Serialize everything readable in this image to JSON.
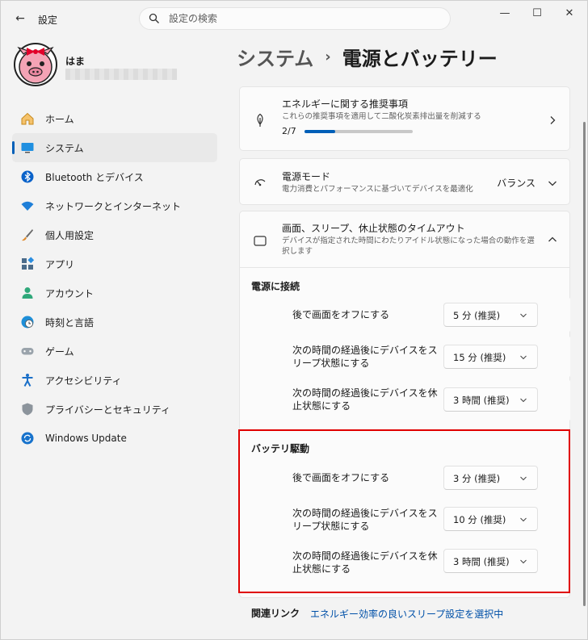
{
  "window": {
    "app_title": "設定",
    "back_icon": "←",
    "min_icon": "—",
    "max_icon": "☐",
    "close_icon": "✕"
  },
  "search": {
    "placeholder": "設定の検索"
  },
  "profile": {
    "name": "はま"
  },
  "sidebar": {
    "items": [
      {
        "label": "ホーム",
        "icon": "home-icon"
      },
      {
        "label": "システム",
        "icon": "system-icon",
        "active": true
      },
      {
        "label": "Bluetooth とデバイス",
        "icon": "bluetooth-icon"
      },
      {
        "label": "ネットワークとインターネット",
        "icon": "wifi-icon"
      },
      {
        "label": "個人用設定",
        "icon": "brush-icon"
      },
      {
        "label": "アプリ",
        "icon": "apps-icon"
      },
      {
        "label": "アカウント",
        "icon": "account-icon"
      },
      {
        "label": "時刻と言語",
        "icon": "globe-clock-icon"
      },
      {
        "label": "ゲーム",
        "icon": "gamepad-icon"
      },
      {
        "label": "アクセシビリティ",
        "icon": "accessibility-icon"
      },
      {
        "label": "プライバシーとセキュリティ",
        "icon": "shield-icon"
      },
      {
        "label": "Windows Update",
        "icon": "update-icon"
      }
    ]
  },
  "breadcrumb": {
    "parent": "システム",
    "separator": "›",
    "current": "電源とバッテリー"
  },
  "recommendations": {
    "title": "エネルギーに関する推奨事項",
    "subtitle": "これらの推奨事項を適用して二酸化炭素排出量を削減する",
    "progress_text": "2/7",
    "progress_value": 0.286
  },
  "power_mode": {
    "title": "電源モード",
    "subtitle": "電力消費とパフォーマンスに基づいてデバイスを最適化",
    "value": "バランス"
  },
  "timeouts": {
    "title": "画面、スリープ、休止状態のタイムアウト",
    "subtitle": "デバイスが指定された時間にわたりアイドル状態になった場合の動作を選択します"
  },
  "plugged_in": {
    "label": "電源に接続",
    "rows": [
      {
        "label": "後で画面をオフにする",
        "value": "5 分 (推奨)"
      },
      {
        "label": "次の時間の経過後にデバイスをスリープ状態にする",
        "value": "15 分 (推奨)"
      },
      {
        "label": "次の時間の経過後にデバイスを休止状態にする",
        "value": "3 時間 (推奨)"
      }
    ]
  },
  "battery": {
    "label": "バッテリ駆動",
    "rows": [
      {
        "label": "後で画面をオフにする",
        "value": "3 分 (推奨)"
      },
      {
        "label": "次の時間の経過後にデバイスをスリープ状態にする",
        "value": "10 分 (推奨)"
      },
      {
        "label": "次の時間の経過後にデバイスを休止状態にする",
        "value": "3 時間 (推奨)"
      }
    ]
  },
  "related": {
    "label": "関連リンク",
    "link": "エネルギー効率の良いスリープ設定を選択中"
  },
  "colors": {
    "accent": "#005fb8",
    "highlight": "#e00000",
    "link": "#0050a8"
  }
}
